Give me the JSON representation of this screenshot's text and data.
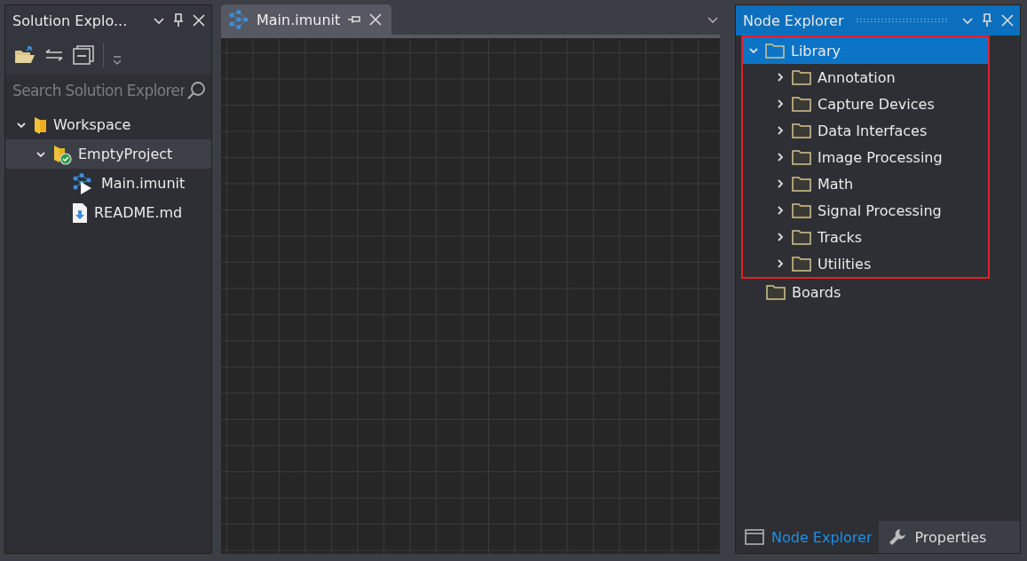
{
  "solution_explorer": {
    "title": "Solution Explo...",
    "search": {
      "placeholder": "Search Solution Explorer"
    },
    "tree": [
      {
        "label": "Workspace",
        "kind": "workspace",
        "expanded": true,
        "selected": false,
        "children": [
          {
            "label": "EmptyProject",
            "kind": "project",
            "expanded": true,
            "selected": true,
            "children": [
              {
                "label": "Main.imunit",
                "kind": "imunit",
                "selected": false
              },
              {
                "label": "README.md",
                "kind": "markdown",
                "selected": false
              }
            ]
          }
        ]
      }
    ]
  },
  "editor": {
    "tabs": [
      {
        "label": "Main.imunit",
        "selected": true
      }
    ]
  },
  "node_explorer": {
    "title": "Node Explorer",
    "tree": [
      {
        "label": "Library",
        "expanded": true,
        "selected": true,
        "highlighted": true,
        "children": [
          {
            "label": "Annotation",
            "expanded": false,
            "selected": false
          },
          {
            "label": "Capture Devices",
            "expanded": false,
            "selected": false
          },
          {
            "label": "Data Interfaces",
            "expanded": false,
            "selected": false
          },
          {
            "label": "Image Processing",
            "expanded": false,
            "selected": false
          },
          {
            "label": "Math",
            "expanded": false,
            "selected": false
          },
          {
            "label": "Signal Processing",
            "expanded": false,
            "selected": false
          },
          {
            "label": "Tracks",
            "expanded": false,
            "selected": false
          },
          {
            "label": "Utilities",
            "expanded": false,
            "selected": false
          }
        ]
      },
      {
        "label": "Boards",
        "selected": false,
        "highlighted": false
      }
    ],
    "bottom_tabs": [
      {
        "label": "Node Explorer",
        "kind": "window",
        "selected": true
      },
      {
        "label": "Properties",
        "kind": "wrench",
        "selected": false
      }
    ]
  }
}
